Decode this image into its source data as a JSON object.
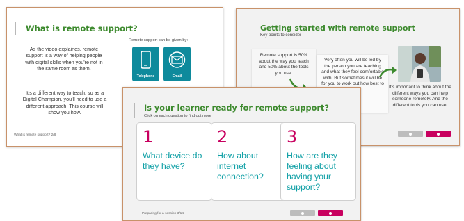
{
  "slide1": {
    "title": "What is remote support?",
    "paragraph1": "As the video explaines, remote support is a way of helping people with digital skills when you're not in the same room as them.",
    "paragraph2": "It's a different way to teach, so as a Digital Champion, you'll need to use a different approach. This course will show you how.",
    "given_by": "Remote support can be given by:",
    "tiles": [
      {
        "label": "Telephone",
        "icon": "phone-icon"
      },
      {
        "label": "Email",
        "icon": "email-icon"
      },
      {
        "label": "",
        "icon": "laptop-icon"
      },
      {
        "label": "",
        "icon": "chat-icon"
      }
    ],
    "footer": "What is remote support? 2/8"
  },
  "slide2": {
    "title": "Getting started with remote support",
    "subtitle": "Key points to consider",
    "card1_text": "Remote support is 50% about the way you teach and 50% about the tools you use.",
    "card2_text": "Very often you will be led by the person you are teaching and what they feel comfortable with. But sometimes it will be for you to work out how best to support",
    "right_text": "It's important to think about the different ways you can help someone remotely. And the different tools you can use."
  },
  "slide3": {
    "title": "Is your learner ready for remote support?",
    "subtitle": "Click on each question to find out more",
    "questions": [
      {
        "num": "1",
        "text": "What device do they have?"
      },
      {
        "num": "2",
        "text": "How about internet connection?"
      },
      {
        "num": "3",
        "text": "How are they feeling about having your support?"
      }
    ],
    "footer": "Preparing for a session 3/14"
  },
  "colors": {
    "title_green": "#3d8a2e",
    "tile_teal": "#0e8a9c",
    "question_teal": "#10a0a6",
    "number_magenta": "#c8005f",
    "next_button": "#c8005f",
    "prev_button": "#bdbdbd",
    "slide_border": "#c8926a"
  }
}
